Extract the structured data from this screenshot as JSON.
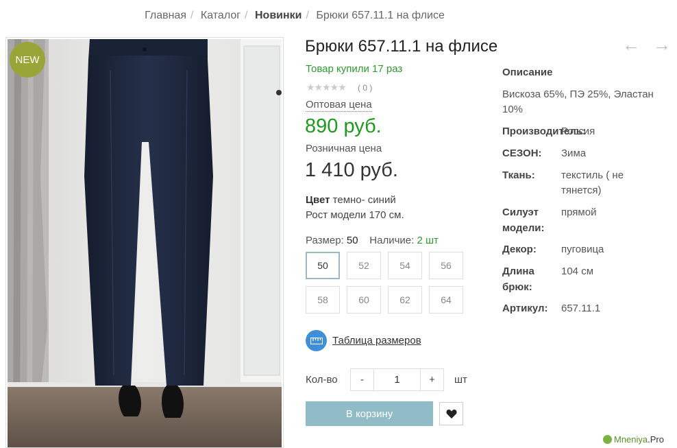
{
  "breadcrumb": {
    "home": "Главная",
    "catalog": "Каталог",
    "section": "Новинки",
    "current": "Брюки 657.11.1 на флисе"
  },
  "product": {
    "badge": "NEW",
    "title": "Брюки 657.11.1 на флисе",
    "bought": "Товар купили 17 раз",
    "stars": "★★★★★",
    "rating_count": "( 0 )",
    "rating_value": 0,
    "wholesale_label": "Оптовая цена",
    "wholesale_price": "890 руб.",
    "retail_label": "Розничная цена",
    "retail_price": "1 410 руб.",
    "color_label": "Цвет",
    "color_value": "темно- синий",
    "model_height": "Рост модели 170 см.",
    "size_label": "Размер:",
    "size_value": "50",
    "stock_label": "Наличие:",
    "stock_value": "2 шт",
    "sizes": [
      "50",
      "52",
      "54",
      "56",
      "58",
      "60",
      "62",
      "64"
    ],
    "selected_size": "50",
    "size_table_label": "Таблица размеров",
    "qty_label": "Кол-во",
    "qty_minus": "-",
    "qty_value": "1",
    "qty_plus": "+",
    "qty_unit": "шт",
    "cart_button": "В корзину"
  },
  "nav": {
    "prev": "←",
    "next": "→"
  },
  "description": {
    "title": "Описание",
    "text": "Вискоза 65%, ПЭ 25%, Эластан 10%",
    "specs": [
      {
        "key": "Производитель:",
        "value": "Россия"
      },
      {
        "key": "СЕЗОН:",
        "value": "Зима"
      },
      {
        "key": "Ткань:",
        "value": "текстиль ( не тянется)"
      },
      {
        "key": "Силуэт модели:",
        "value": "прямой"
      },
      {
        "key": "Декор:",
        "value": "пуговица"
      },
      {
        "key": "Длина брюк:",
        "value": "104 см"
      },
      {
        "key": "Артикул:",
        "value": "657.11.1"
      }
    ]
  },
  "watermark": {
    "name": "Mneniya",
    "suffix": ".Pro"
  },
  "colors": {
    "price_green": "#1e9a1e",
    "badge": "#9aa537",
    "cart_button": "#8fbcc6",
    "ruler_icon": "#3f8fd8",
    "pants": "#1c2437"
  }
}
